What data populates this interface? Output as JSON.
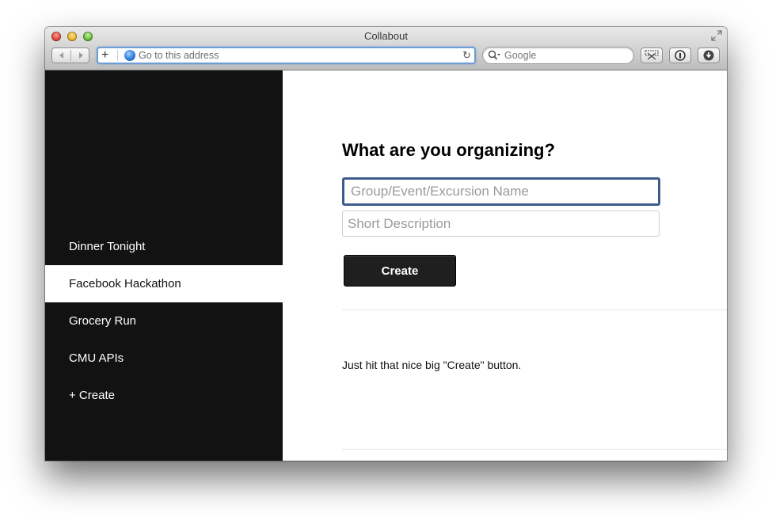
{
  "window": {
    "title": "Collabout"
  },
  "toolbar": {
    "address_placeholder": "Go to this address",
    "search_placeholder": "Google",
    "new_tab_label": "+"
  },
  "sidebar": {
    "items": [
      {
        "label": "Dinner Tonight",
        "active": false
      },
      {
        "label": "Facebook Hackathon",
        "active": true
      },
      {
        "label": "Grocery Run",
        "active": false
      },
      {
        "label": "CMU APIs",
        "active": false
      },
      {
        "label": "+ Create",
        "active": false
      }
    ]
  },
  "form": {
    "heading": "What are you organizing?",
    "name_placeholder": "Group/Event/Excursion Name",
    "description_placeholder": "Short Description",
    "create_label": "Create"
  },
  "hint": "Just hit that nice big \"Create\" button.",
  "colors": {
    "sidebar_bg": "#121212",
    "active_item_bg": "#ffffff",
    "focus_border": "#3d5a8c",
    "button_bg": "#1f1f1f"
  }
}
